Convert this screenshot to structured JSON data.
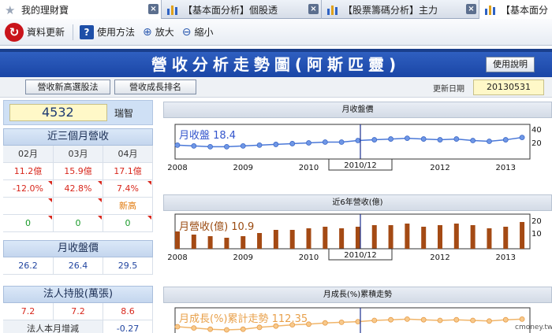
{
  "tabs": [
    {
      "label": "我的理財寶",
      "icon": "star-icon"
    },
    {
      "label": "【基本面分析】個股透",
      "icon": "bar-chart-icon"
    },
    {
      "label": "【股票籌碼分析】主力",
      "icon": "bar-chart-icon"
    },
    {
      "label": "【基本面分",
      "icon": "bar-chart-icon"
    }
  ],
  "toolbar": {
    "refresh": "資料更新",
    "help": "使用方法",
    "zoom_in": "放大",
    "zoom_out": "縮小"
  },
  "header": {
    "title": "營收分析走勢圖(阿斯匹靈)",
    "usage_button": "使用說明"
  },
  "subbar": {
    "btn_new_high": "營收新高選股法",
    "btn_growth_rank": "營收成長排名",
    "update_label": "更新日期",
    "update_value": "20130531"
  },
  "stock": {
    "code": "4532",
    "name": "瑞智"
  },
  "revenue3": {
    "title": "近三個月營收",
    "months": [
      "02月",
      "03月",
      "04月"
    ],
    "values": [
      "11.2億",
      "15.9億",
      "17.1億"
    ],
    "yoy": [
      "-12.0%",
      "42.8%",
      "7.4%"
    ],
    "notes": [
      "",
      "",
      "新高"
    ],
    "counts": [
      "0",
      "0",
      "0"
    ]
  },
  "price": {
    "title": "月收盤價",
    "values": [
      "26.2",
      "26.4",
      "29.5"
    ]
  },
  "institution": {
    "title": "法人持股(萬張)",
    "values": [
      "7.2",
      "7.2",
      "8.6"
    ],
    "monthly_label": "法人本月增減",
    "monthly_value": "-0.27"
  },
  "charts": {
    "price_title": "月收盤價",
    "price_legend": "月收盤 18.4",
    "revenue_title": "近6年營收(億)",
    "revenue_legend": "月營收(億) 10.9",
    "growth_title": "月成長(%)累積走勢",
    "growth_legend": "月成長(%)累計走勢 112.35",
    "cursor_label": "2010/12",
    "year_ticks": [
      "2008",
      "2009",
      "2010",
      "2012",
      "2013"
    ],
    "price_ticks": [
      "40",
      "20"
    ],
    "revenue_ticks": [
      "20",
      "10"
    ]
  },
  "chart_data": [
    {
      "type": "line",
      "x": [
        "2008-01",
        "2008-04",
        "2008-07",
        "2008-10",
        "2009-01",
        "2009-04",
        "2009-07",
        "2009-10",
        "2010-01",
        "2010-04",
        "2010-07",
        "2010-10",
        "2011-01",
        "2011-04",
        "2011-07",
        "2011-10",
        "2012-01",
        "2012-04",
        "2012-07",
        "2012-10",
        "2013-01",
        "2013-04"
      ],
      "values": [
        18,
        17,
        16,
        16,
        17,
        18,
        19,
        20,
        21,
        22,
        22,
        24,
        25,
        26,
        27,
        26,
        25,
        26,
        24,
        23,
        25,
        28
      ],
      "ylim": [
        0,
        45
      ]
    },
    {
      "type": "bar",
      "x": [
        "2008-01",
        "2008-04",
        "2008-07",
        "2008-10",
        "2009-01",
        "2009-04",
        "2009-07",
        "2009-10",
        "2010-01",
        "2010-04",
        "2010-07",
        "2010-10",
        "2011-01",
        "2011-04",
        "2011-07",
        "2011-10",
        "2012-01",
        "2012-04",
        "2012-07",
        "2012-10",
        "2013-01",
        "2013-04"
      ],
      "values": [
        11,
        9,
        8,
        7,
        8,
        10,
        12,
        12,
        13,
        14,
        13,
        14,
        15,
        15,
        16,
        14,
        15,
        16,
        15,
        13,
        14,
        17
      ],
      "ylim": [
        0,
        22
      ]
    },
    {
      "type": "line",
      "x": [
        "2008-01",
        "2008-04",
        "2008-07",
        "2008-10",
        "2009-01",
        "2009-04",
        "2009-07",
        "2009-10",
        "2010-01",
        "2010-04",
        "2010-07",
        "2010-10",
        "2011-01",
        "2011-04",
        "2011-07",
        "2011-10",
        "2012-01",
        "2012-04",
        "2012-07",
        "2012-10",
        "2013-01",
        "2013-04"
      ],
      "values": [
        100,
        98,
        96,
        95,
        96,
        99,
        101,
        103,
        104,
        106,
        107,
        108,
        110,
        111,
        112,
        111,
        110,
        111,
        110,
        109,
        111,
        112
      ],
      "ylim": [
        80,
        130
      ]
    }
  ],
  "watermark": "cmoney.tw"
}
